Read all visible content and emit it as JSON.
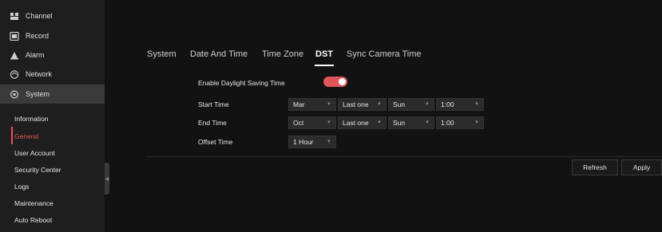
{
  "sidebar": {
    "items": [
      {
        "label": "Channel",
        "icon": "channel-icon"
      },
      {
        "label": "Record",
        "icon": "record-icon"
      },
      {
        "label": "Alarm",
        "icon": "alarm-icon"
      },
      {
        "label": "Network",
        "icon": "network-icon"
      },
      {
        "label": "System",
        "icon": "gear-icon"
      }
    ],
    "subitems": [
      {
        "label": "Information"
      },
      {
        "label": "General"
      },
      {
        "label": "User Account"
      },
      {
        "label": "Security Center"
      },
      {
        "label": "Logs"
      },
      {
        "label": "Maintenance"
      },
      {
        "label": "Auto Reboot"
      }
    ]
  },
  "tabs": [
    {
      "label": "System"
    },
    {
      "label": "Date And Time"
    },
    {
      "label": "Time Zone"
    },
    {
      "label": "DST"
    },
    {
      "label": "Sync Camera Time"
    }
  ],
  "form": {
    "enable_label": "Enable Daylight Saving Time",
    "enable_on": true,
    "start_label": "Start Time",
    "start": {
      "month": "Mar",
      "week": "Last one",
      "day": "Sun",
      "time": "1:00"
    },
    "end_label": "End Time",
    "end": {
      "month": "Oct",
      "week": "Last one",
      "day": "Sun",
      "time": "1:00"
    },
    "offset_label": "Offset Time",
    "offset": "1 Hour"
  },
  "buttons": {
    "refresh": "Refresh",
    "apply": "Apply"
  },
  "colors": {
    "accent": "#e0555a",
    "background": "#121212",
    "sidebar": "#1e1e1e"
  }
}
